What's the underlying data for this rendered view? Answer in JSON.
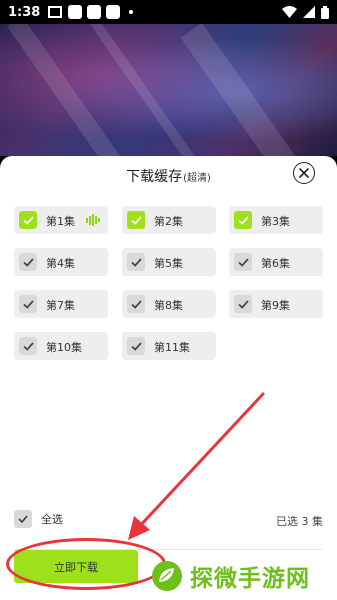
{
  "status_bar": {
    "time": "1:38"
  },
  "sheet": {
    "title": "下载缓存",
    "quality": "(超清)"
  },
  "episodes": [
    {
      "label": "第1集",
      "checked": true,
      "playing": true
    },
    {
      "label": "第2集",
      "checked": true,
      "playing": false
    },
    {
      "label": "第3集",
      "checked": true,
      "playing": false
    },
    {
      "label": "第4集",
      "checked": false,
      "playing": false
    },
    {
      "label": "第5集",
      "checked": false,
      "playing": false
    },
    {
      "label": "第6集",
      "checked": false,
      "playing": false
    },
    {
      "label": "第7集",
      "checked": false,
      "playing": false
    },
    {
      "label": "第8集",
      "checked": false,
      "playing": false
    },
    {
      "label": "第9集",
      "checked": false,
      "playing": false
    },
    {
      "label": "第10集",
      "checked": false,
      "playing": false
    },
    {
      "label": "第11集",
      "checked": false,
      "playing": false
    }
  ],
  "footer": {
    "select_all_label": "全选",
    "selected_count": "已选 3 集",
    "download_label": "立即下载"
  },
  "watermark": {
    "text": "探微手游网"
  },
  "colors": {
    "accent": "#9ee01c",
    "annotation_red": "#e8343c",
    "watermark_green": "#6cc019"
  }
}
